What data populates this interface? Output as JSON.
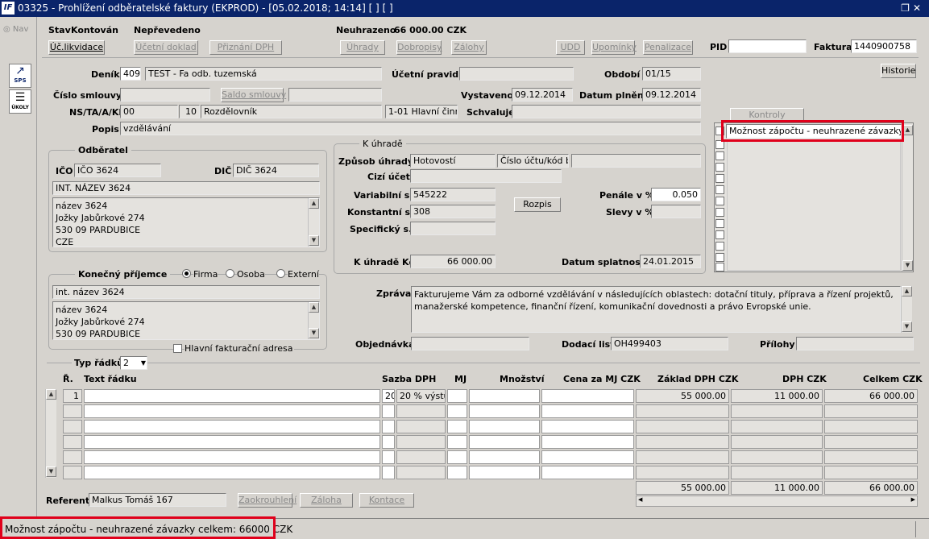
{
  "window": {
    "title": "03325 - Prohlížení odběratelské faktury (EKPROD) - [05.02.2018; 14:14]  [ ]  [ ]",
    "logo_text": "IF"
  },
  "leftbar": {
    "nav_label": "Nav",
    "sps_label": "SPS",
    "ukoly_label": "ÚKOLY"
  },
  "header": {
    "stav_label": "Stav",
    "stav_value": "Kontován",
    "neprevedeno": "Nepřevedeno",
    "neuhrazeno_label": "Neuhrazeno",
    "neuhrazeno_value": "66 000.00 CZK",
    "pid_label": "PID",
    "pid_value": "",
    "faktura_label": "Faktura",
    "faktura_value": "1440900758"
  },
  "toolbar": {
    "uc_likvidace": "Úč.likvidace",
    "ucetni_doklad": "Účetní doklad",
    "priznani_dph": "Přiznání DPH",
    "uhrady": "Úhrady",
    "dobropisy": "Dobropisy",
    "zalohy": "Zálohy",
    "udd": "UDD",
    "upominky": "Upomínky",
    "penalizace": "Penalizace",
    "historie": "Historie"
  },
  "form": {
    "denik_label": "Deník",
    "denik_code": "409",
    "denik_name": "TEST - Fa odb. tuzemská",
    "ucetni_pravidlo_label": "Účetní pravidlo",
    "ucetni_pravidlo_value": "",
    "obdobi_label": "Období",
    "obdobi_value": "01/15",
    "cislo_smlouvy_label": "Číslo smlouvy",
    "cislo_smlouvy_value": "",
    "saldo_smlouvy": "Saldo smlouvy",
    "saldo_value": "",
    "vystaveno_label": "Vystaveno",
    "vystaveno_value": "09.12.2014",
    "datum_plneni_label": "Datum plnění",
    "datum_plneni_value": "09.12.2014",
    "ns_label": "NS/TA/A/KP",
    "ns_value": "00",
    "ta_value": "10",
    "ta_name": "Rozdělovník",
    "kp_value": "1-01 Hlavní činnost",
    "schvaluje_label": "Schvaluje",
    "schvaluje_value": "",
    "popis_label": "Popis",
    "popis_value": "vzdělávání"
  },
  "odberatel": {
    "title": "Odběratel",
    "ico_label": "IČO",
    "ico_value": "IČO 3624",
    "dic_label": "DIČ",
    "dic_value": "DIČ 3624",
    "int_nazev": "INT. NÁZEV 3624",
    "address": [
      "název 3624",
      "Jožky Jabůrkové 274",
      "530 09 PARDUBICE",
      "CZE"
    ]
  },
  "prijemce": {
    "title": "Konečný příjemce",
    "radio_firma": "Firma",
    "radio_osoba": "Osoba",
    "radio_externi": "Externí",
    "int_nazev": "int. název 3624",
    "address": [
      "název 3624",
      "Jožky Jabůrkové 274",
      "530 09 PARDUBICE"
    ],
    "hlavni_adresa": "Hlavní fakturační adresa"
  },
  "uhrada": {
    "title": "K úhradě",
    "zpusob_label": "Způsob úhrady",
    "zpusob_value": "Hotovostí",
    "cislo_uctu": "Číslo účtu/kód banky",
    "ucet_value": "",
    "cizi_ucet_label": "Cizí účet",
    "cizi_ucet_value": "",
    "variabilni_label": "Variabilní s.",
    "variabilni_value": "545222",
    "konstantni_label": "Konstantní s.",
    "konstantni_value": "308",
    "specificky_label": "Specifický s.",
    "specificky_value": "",
    "rozpis": "Rozpis",
    "penale_label": "Penále v %",
    "penale_value": "0.050",
    "slevy_label": "Slevy v %",
    "slevy_value": "",
    "k_uhrade_label": "K úhradě Kč",
    "k_uhrade_value": "66 000.00",
    "splatnost_label": "Datum splatnosti",
    "splatnost_value": "24.01.2015"
  },
  "kontroly": {
    "title": "Kontroly",
    "items": [
      "Možnost zápočtu - neuhrazené závazky celkem"
    ]
  },
  "zprava": {
    "label": "Zpráva",
    "text": "Fakturujeme Vám za odborné vzdělávání v následujících oblastech: dotační tituly, příprava a řízení projektů, manažerské kompetence, finanční řízení, komunikační dovednosti a právo Evropské unie."
  },
  "docs": {
    "objednavka_label": "Objednávka",
    "objednavka_value": "",
    "dodaci_label": "Dodací list",
    "dodaci_value": "OH499403",
    "prilohy_label": "Přílohy",
    "prilohy_value": ""
  },
  "grid": {
    "typ_radku_label": "Typ řádků",
    "typ_radku_value": "2",
    "headers": {
      "r": "Ř.",
      "text": "Text řádku",
      "sazba": "Sazba DPH",
      "mj": "MJ",
      "mnozstvi": "Množství",
      "cena": "Cena za MJ CZK",
      "zaklad": "Základ DPH CZK",
      "dph": "DPH CZK",
      "celkem": "Celkem CZK"
    },
    "rows": [
      {
        "r": "1",
        "text": "",
        "sazba_code": "20",
        "sazba": "20 % výstup",
        "mj": "",
        "mnozstvi": "",
        "cena": "",
        "zaklad": "55 000.00",
        "dph": "11 000.00",
        "celkem": "66 000.00"
      }
    ],
    "totals": {
      "zaklad": "55 000.00",
      "dph": "11 000.00",
      "celkem": "66 000.00"
    }
  },
  "footer": {
    "referent_label": "Referent",
    "referent_value": "Malkus Tomáš 167",
    "zaokrouhleni": "Zaokrouhlení",
    "zaloha": "Záloha",
    "kontace": "Kontace"
  },
  "status": {
    "message": "Možnost zápočtu - neuhrazené závazky celkem: 66000 CZK"
  },
  "colors": {
    "titlebar": "#0a246a",
    "highlight": "#e0001b",
    "background": "#d6d3ce"
  }
}
